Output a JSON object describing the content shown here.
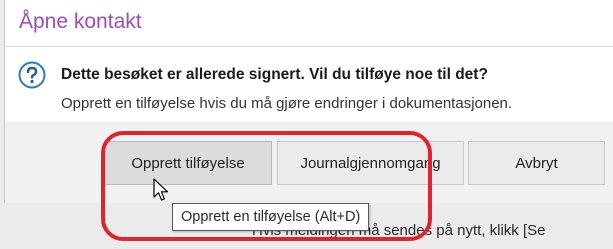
{
  "dialog": {
    "title": "Åpne kontakt",
    "question_icon": "question-mark-icon",
    "message_main": "Dette besøket er allerede signert. Vil du tilføye noe til det?",
    "message_sub": "Opprett en tilføyelse hvis du må gjøre endringer i dokumentasjonen.",
    "buttons": {
      "create_addendum": "Opprett tilføyelse",
      "journal_review": "Journalgjennomgang",
      "cancel": "Avbryt"
    }
  },
  "tooltip": {
    "text": "Opprett en tilføyelse (Alt+D)"
  },
  "background_text": "Hvis meldingen må sendes på nytt, klikk [Se",
  "highlight_color": "#e0242b",
  "title_color": "#9b4fb4",
  "cursor_icon": "arrow-pointer-icon"
}
